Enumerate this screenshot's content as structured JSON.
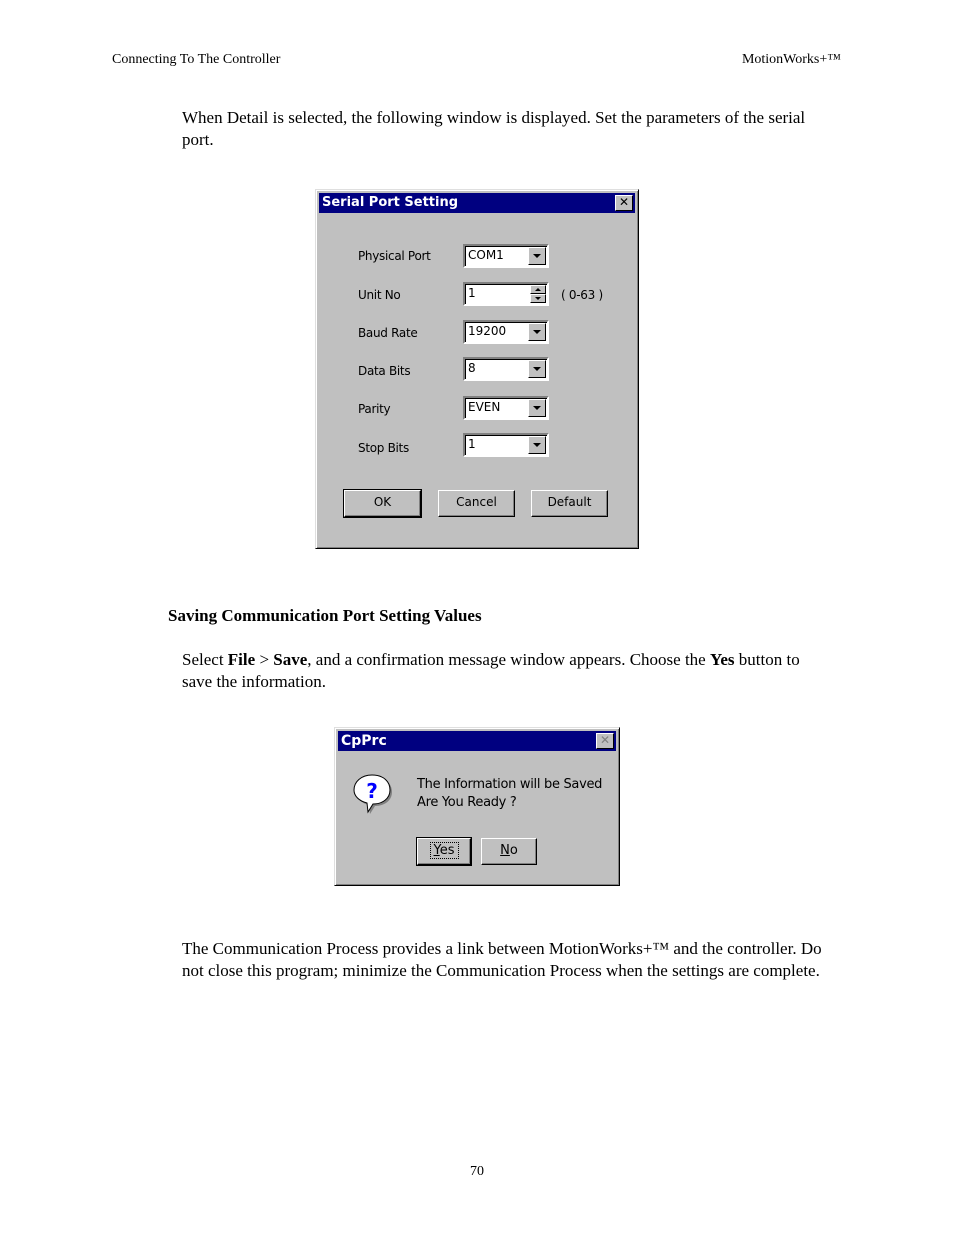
{
  "page_header": {
    "left": "Connecting To The Controller",
    "right": "MotionWorks+™"
  },
  "intro_text": "When Detail is selected, the following window is displayed. Set the parameters of the serial port.",
  "serial_dialog": {
    "title": "Serial Port Setting",
    "close_label": "✕",
    "fields": {
      "physical_port": {
        "label": "Physical Port",
        "value": "COM1"
      },
      "unit_no": {
        "label": "Unit No",
        "value": "1",
        "range_hint": "( 0-63 )"
      },
      "baud_rate": {
        "label": "Baud Rate",
        "value": "19200"
      },
      "data_bits": {
        "label": "Data Bits",
        "value": "8"
      },
      "parity": {
        "label": "Parity",
        "value": "EVEN"
      },
      "stop_bits": {
        "label": "Stop Bits",
        "value": "1"
      }
    },
    "buttons": {
      "ok": "OK",
      "cancel": "Cancel",
      "default": "Default"
    }
  },
  "section_heading": "Saving Communication Port Setting Values",
  "save_text": {
    "p1": "Select ",
    "file": "File",
    "p2": " > ",
    "save": "Save",
    "p3": ", and a confirmation message window appears.   Choose the ",
    "yes": "Yes",
    "p4": " button to save the information."
  },
  "confirm_dialog": {
    "title": "CpPrc",
    "close_label": "✕",
    "icon": "question-icon",
    "message_line1": "The Information will be Saved",
    "message_line2": "Are You Ready ?",
    "yes_mnemonic": "Y",
    "yes_rest": "es",
    "no_mnemonic": "N",
    "no_rest": "o"
  },
  "closing_text": "The Communication Process provides a link between MotionWorks+™ and the controller.  Do not close this program; minimize the Communication Process when the settings are complete.",
  "page_number": "70"
}
